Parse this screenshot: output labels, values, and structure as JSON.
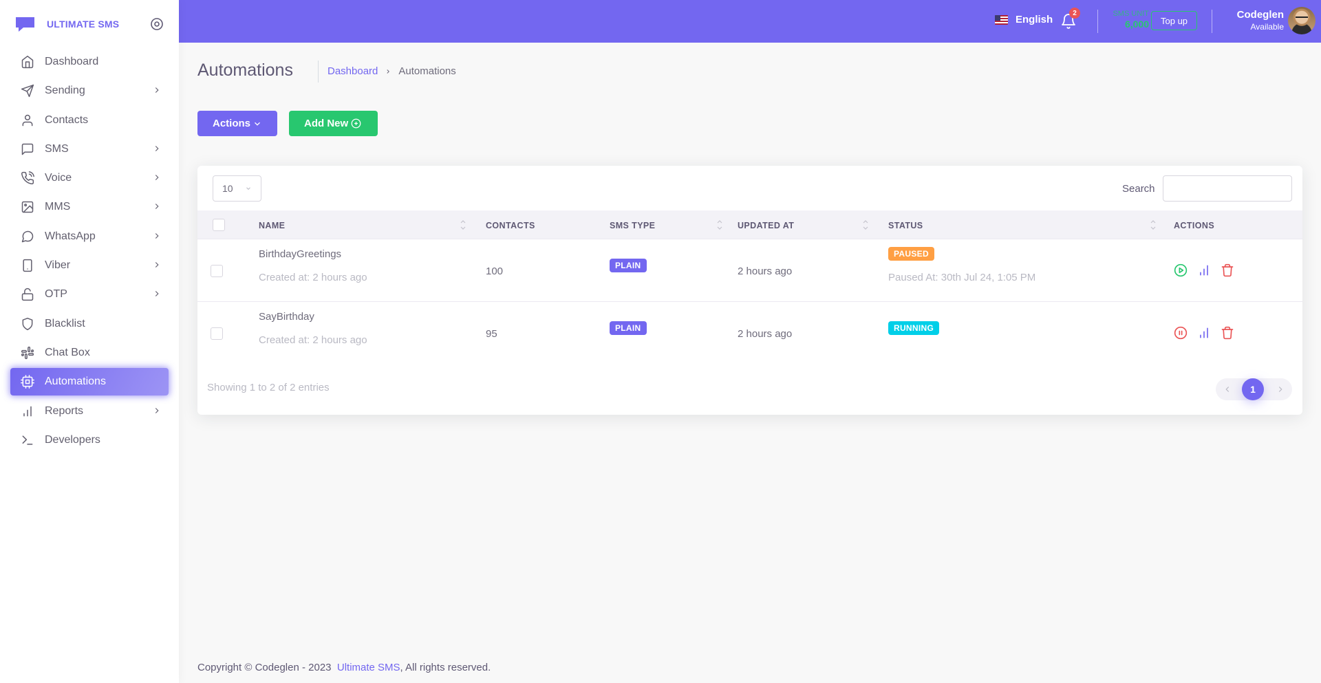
{
  "brand": {
    "name": "ULTIMATE SMS"
  },
  "nav": [
    {
      "label": "Dashboard",
      "icon": "home-icon",
      "has_children": false
    },
    {
      "label": "Sending",
      "icon": "send-icon",
      "has_children": true
    },
    {
      "label": "Contacts",
      "icon": "user-icon",
      "has_children": false
    },
    {
      "label": "SMS",
      "icon": "message-square-icon",
      "has_children": true
    },
    {
      "label": "Voice",
      "icon": "phone-call-icon",
      "has_children": true
    },
    {
      "label": "MMS",
      "icon": "image-icon",
      "has_children": true
    },
    {
      "label": "WhatsApp",
      "icon": "message-circle-icon",
      "has_children": true
    },
    {
      "label": "Viber",
      "icon": "smartphone-icon",
      "has_children": true
    },
    {
      "label": "OTP",
      "icon": "unlock-icon",
      "has_children": true
    },
    {
      "label": "Blacklist",
      "icon": "shield-icon",
      "has_children": false
    },
    {
      "label": "Chat Box",
      "icon": "slack-icon",
      "has_children": false
    },
    {
      "label": "Automations",
      "icon": "cpu-icon",
      "has_children": false,
      "active": true
    },
    {
      "label": "Reports",
      "icon": "bar-chart-icon",
      "has_children": true
    },
    {
      "label": "Developers",
      "icon": "terminal-icon",
      "has_children": false
    }
  ],
  "topbar": {
    "language": "English",
    "notifications_count": "2",
    "sms_unit_label": "SMS UNIT",
    "sms_unit_value": "6,000",
    "topup_label": "Top up",
    "user_name": "Codeglen",
    "user_status": "Available"
  },
  "page": {
    "title": "Automations",
    "breadcrumb": {
      "home": "Dashboard",
      "current": "Automations"
    },
    "actions_label": "Actions",
    "add_new_label": "Add New"
  },
  "table": {
    "page_length": "10",
    "search_label": "Search",
    "search_value": "",
    "columns": [
      "Name",
      "Contacts",
      "SMS Type",
      "Updated At",
      "Status",
      "Actions"
    ],
    "rows": [
      {
        "name": "BirthdayGreetings",
        "created": "Created at: 2 hours ago",
        "contacts": "100",
        "sms_type": "PLAIN",
        "updated_at": "2 hours ago",
        "status": "PAUSED",
        "status_detail": "Paused At: 30th Jul 24, 1:05 PM",
        "toggle_action": "play"
      },
      {
        "name": "SayBirthday",
        "created": "Created at: 2 hours ago",
        "contacts": "95",
        "sms_type": "PLAIN",
        "updated_at": "2 hours ago",
        "status": "RUNNING",
        "status_detail": "",
        "toggle_action": "pause"
      }
    ],
    "info": "Showing 1 to 2 of 2 entries",
    "current_page": "1"
  },
  "footer": {
    "prefix": "Copyright © Codeglen - 2023",
    "link": "Ultimate SMS",
    "suffix": ", All rights reserved."
  },
  "colors": {
    "primary": "#7367f0",
    "success": "#28c76f",
    "warning": "#ff9f43",
    "info": "#00cfe8",
    "danger": "#ea5455"
  }
}
